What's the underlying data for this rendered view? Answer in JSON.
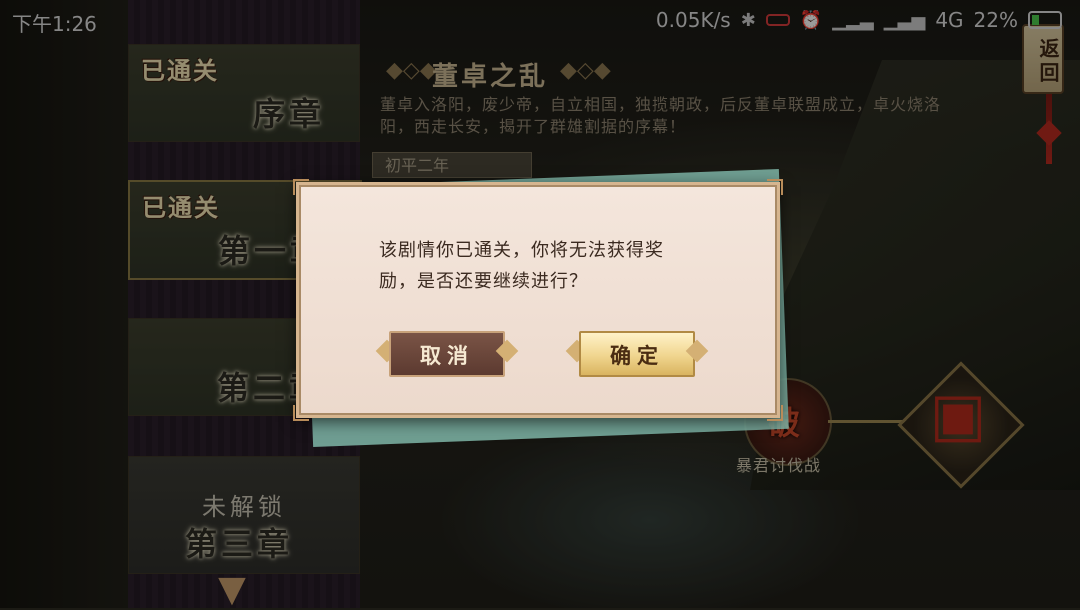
{
  "status_bar": {
    "time": "下午1:26",
    "network_speed": "0.05K/s",
    "network_type": "4G",
    "battery": "22%",
    "battery_level": 0.22
  },
  "back_button": {
    "label": "返回"
  },
  "chapters": [
    {
      "badge": "已通关",
      "title": "序章"
    },
    {
      "badge": "已通关",
      "title": "第一章"
    },
    {
      "badge": "",
      "title": "第二章"
    },
    {
      "status": "未解锁",
      "title": "第三章"
    }
  ],
  "chapter_detail": {
    "name": "董卓之乱",
    "description": "董卓入洛阳，废少帝，自立相国，独揽朝政，后反董卓联盟成立，卓火烧洛阳，西走长安，揭开了群雄割据的序幕！",
    "era": "初平二年"
  },
  "stage": {
    "icon_text": "破",
    "name": "暴君讨伐战"
  },
  "dialog": {
    "message": "该剧情你已通关，你将无法获得奖励，是否还要继续进行？",
    "cancel_label": "取消",
    "confirm_label": "确定"
  }
}
